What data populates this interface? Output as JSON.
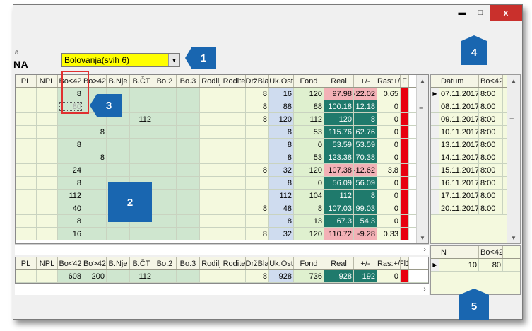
{
  "window": {
    "minimize_icon": "minimize-icon",
    "maximize_icon": "maximize-icon",
    "close_label": "x",
    "minimize_label": "▬",
    "maximize_label": "□"
  },
  "header": {
    "partial_small": "a",
    "partial_big": "NA"
  },
  "combo": {
    "value": "Bolovanja(svih 6)",
    "arrow": "▼"
  },
  "callouts": [
    "1",
    "2",
    "3",
    "4",
    "5"
  ],
  "main_grid": {
    "columns": [
      "PL",
      "NPL",
      "Bo<42",
      "Bo>42",
      "B.Nje",
      "B.ČT",
      "Bo.2",
      "Bo.3",
      "Rodilj",
      "Rodite",
      "DržBla",
      "Uk.Ost",
      "Fond",
      "Real",
      "+/-",
      "Ras:+/",
      "F"
    ],
    "rows": [
      [
        "",
        "",
        "8",
        "",
        "",
        "",
        "",
        "",
        "",
        "",
        "8",
        "16",
        "120",
        "97.98",
        "-22.02",
        "0.65",
        ""
      ],
      [
        "",
        "",
        "80",
        "",
        "",
        "",
        "",
        "",
        "",
        "",
        "8",
        "88",
        "88",
        "100.18",
        "12.18",
        "0",
        ""
      ],
      [
        "",
        "",
        "",
        "",
        "",
        "112",
        "",
        "",
        "",
        "",
        "8",
        "120",
        "112",
        "120",
        "8",
        "0",
        ""
      ],
      [
        "",
        "",
        "",
        "8",
        "",
        "",
        "",
        "",
        "",
        "",
        "",
        "8",
        "53",
        "115.76",
        "62.76",
        "0",
        ""
      ],
      [
        "",
        "",
        "8",
        "",
        "",
        "",
        "",
        "",
        "",
        "",
        "",
        "8",
        "0",
        "53.59",
        "53.59",
        "0",
        ""
      ],
      [
        "",
        "",
        "",
        "8",
        "",
        "",
        "",
        "",
        "",
        "",
        "",
        "8",
        "53",
        "123.38",
        "70.38",
        "0",
        ""
      ],
      [
        "",
        "",
        "24",
        "",
        "",
        "",
        "",
        "",
        "",
        "",
        "8",
        "32",
        "120",
        "107.38",
        "-12.62",
        "3.8",
        ""
      ],
      [
        "",
        "",
        "8",
        "",
        "",
        "",
        "",
        "",
        "",
        "",
        "",
        "8",
        "0",
        "56.09",
        "56.09",
        "0",
        ""
      ],
      [
        "",
        "",
        "112",
        "",
        "",
        "",
        "",
        "",
        "",
        "",
        "",
        "112",
        "104",
        "112",
        "8",
        "0",
        ""
      ],
      [
        "",
        "",
        "40",
        "",
        "",
        "",
        "",
        "",
        "",
        "",
        "8",
        "48",
        "8",
        "107.03",
        "99.03",
        "0",
        ""
      ],
      [
        "",
        "",
        "8",
        "",
        "",
        "",
        "",
        "",
        "",
        "",
        "",
        "8",
        "13",
        "67.3",
        "54.3",
        "0",
        ""
      ],
      [
        "",
        "",
        "16",
        "",
        "",
        "",
        "",
        "",
        "",
        "",
        "8",
        "32",
        "120",
        "110.72",
        "-9.28",
        "0.33",
        ""
      ]
    ]
  },
  "totals_grid": {
    "columns": [
      "PL",
      "NPL",
      "Bo<42",
      "Bo>42",
      "B.Nje",
      "B.ČT",
      "Bo.2",
      "Bo.3",
      "Rodilj",
      "Rodite",
      "DržBla",
      "Uk.Ost",
      "Fond",
      "Real",
      "+/-",
      "Ras:+/",
      "Fl1"
    ],
    "rows": [
      [
        "",
        "",
        "608",
        "200",
        "",
        "112",
        "",
        "",
        "",
        "",
        "8",
        "928",
        "736",
        "928",
        "192",
        "0",
        ""
      ]
    ]
  },
  "dates_grid": {
    "columns": [
      "Datum",
      "Bo<42"
    ],
    "rows": [
      [
        "07.11.2017",
        "8:00"
      ],
      [
        "08.11.2017",
        "8:00"
      ],
      [
        "09.11.2017",
        "8:00"
      ],
      [
        "10.11.2017",
        "8:00"
      ],
      [
        "13.11.2017",
        "8:00"
      ],
      [
        "14.11.2017",
        "8:00"
      ],
      [
        "15.11.2017",
        "8:00"
      ],
      [
        "16.11.2017",
        "8:00"
      ],
      [
        "17.11.2017",
        "8:00"
      ],
      [
        "20.11.2017",
        "8:00"
      ]
    ]
  },
  "summary_grid": {
    "columns": [
      "N",
      "Bo<42"
    ],
    "rows": [
      [
        "10",
        "80"
      ]
    ]
  },
  "scroll": {
    "up": "▲",
    "down": "▼",
    "right": "›",
    "grip": "≡",
    "pointer": "▶"
  },
  "colors": {
    "highlight": "#ffff00",
    "callout": "#1966b0",
    "pink": "#f3b1b6",
    "teal": "#1f7a6c",
    "red": "#e8000d"
  }
}
